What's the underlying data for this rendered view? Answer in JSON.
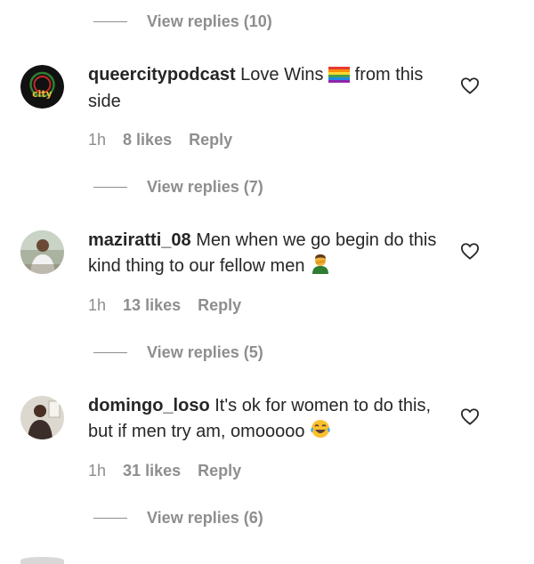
{
  "replies": [
    {
      "line": "",
      "label": "View replies (10)"
    },
    {
      "label": "View replies (7)"
    },
    {
      "label": "View replies (5)"
    },
    {
      "label": "View replies (6)"
    }
  ],
  "comments": [
    {
      "username": "queercitypodcast",
      "text_before": "Love Wins",
      "text_after": "from this side",
      "emoji": "rainbow-flag",
      "time": "1h",
      "likes": "8 likes",
      "reply": "Reply",
      "avatar_text": "city"
    },
    {
      "username": "maziratti_08",
      "text_before": "Men when we go begin do this kind thing to our fellow men",
      "text_after": "",
      "emoji": "man-facepalming",
      "time": "1h",
      "likes": "13 likes",
      "reply": "Reply"
    },
    {
      "username": "domingo_loso",
      "text_before": "It's ok for women to do this, but if men try am, omooooo",
      "text_after": "",
      "emoji": "face-with-tears-of-joy",
      "time": "1h",
      "likes": "31 likes",
      "reply": "Reply"
    }
  ],
  "colors": {
    "text": "#262626",
    "secondary": "#8e8e8e",
    "background": "#ffffff"
  }
}
